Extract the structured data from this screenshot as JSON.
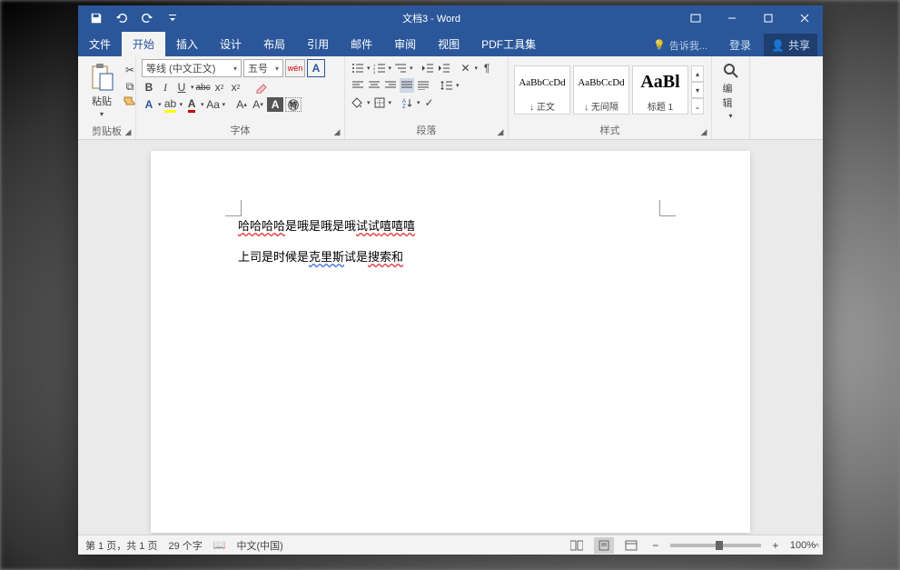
{
  "titlebar": {
    "doc_title": "文档3 - Word"
  },
  "menu": {
    "file": "文件",
    "home": "开始",
    "insert": "插入",
    "design": "设计",
    "layout": "布局",
    "references": "引用",
    "mailings": "邮件",
    "review": "审阅",
    "view": "视图",
    "pdf": "PDF工具集",
    "tellme": "告诉我...",
    "login": "登录",
    "share": "共享"
  },
  "ribbon": {
    "clipboard": {
      "label": "剪贴板",
      "paste": "粘贴"
    },
    "font": {
      "label": "字体",
      "font_name": "等线 (中文正文)",
      "font_size": "五号",
      "pinyin": "wén",
      "B": "B",
      "I": "I",
      "U": "U",
      "abc": "abc"
    },
    "paragraph": {
      "label": "段落"
    },
    "styles": {
      "label": "样式",
      "preview_text": "AaBbCcDd",
      "preview_heading": "AaBl",
      "normal": "↓ 正文",
      "no_spacing": "↓ 无间隔",
      "heading1": "标题 1"
    },
    "editing": {
      "label": "编辑"
    }
  },
  "document": {
    "line1_a": "哈哈哈哈",
    "line1_b": "是哦是哦是哦",
    "line1_c": "试试",
    "line1_d": "嘻嘻嘻",
    "line2_a": "上司是时候是",
    "line2_b": "克里斯",
    "line2_c": "试是",
    "line2_d": "搜索和"
  },
  "status": {
    "page": "第 1 页，共 1 页",
    "words": "29 个字",
    "language": "中文(中国)",
    "zoom": "100%"
  }
}
